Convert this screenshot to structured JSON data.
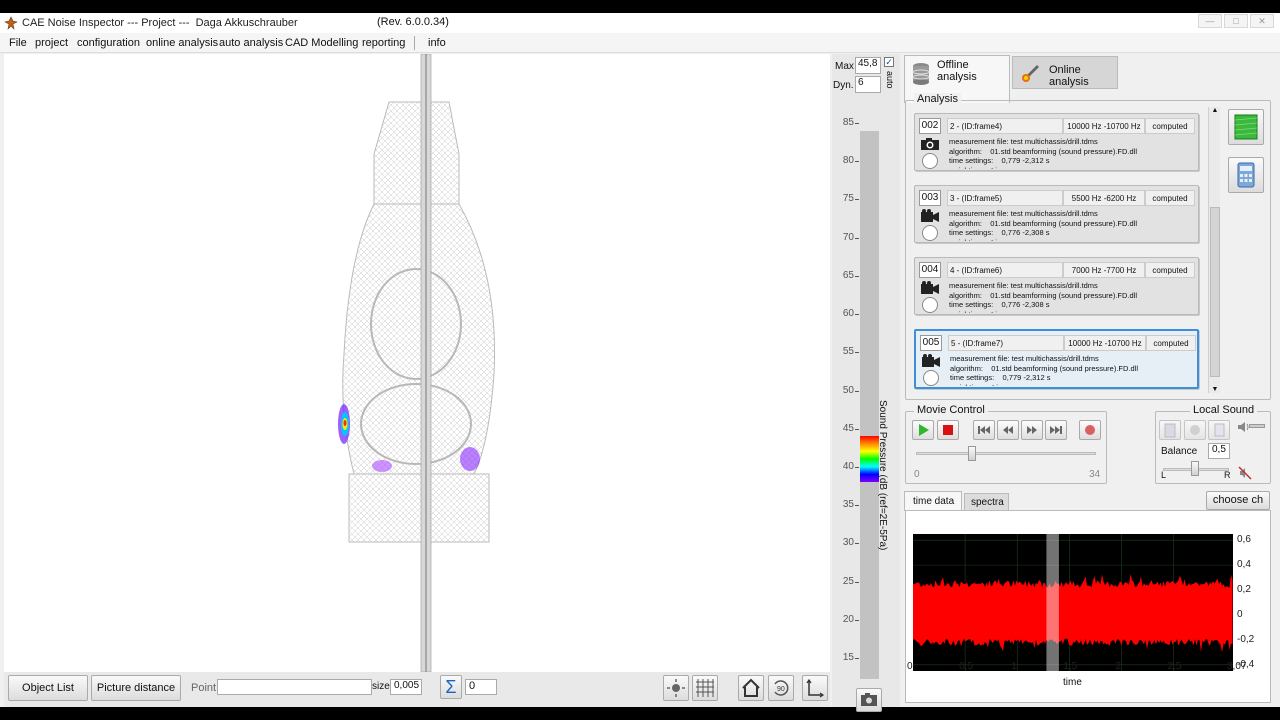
{
  "window": {
    "title": "CAE Noise Inspector --- Project ---  Daga Akkuschrauber",
    "revision": "(Rev. 6.0.0.34)"
  },
  "menu": [
    "File",
    "project",
    "configuration",
    "online analysis",
    "auto analysis",
    "CAD Modelling",
    "reporting",
    "info"
  ],
  "bottom_bar": {
    "object_list": "Object List",
    "picture_distance": "Picture distance",
    "point_label": "Point",
    "point_value": "",
    "size_label": "size",
    "size_value": "0,005",
    "sigma_symbol": "Σ",
    "sum_value": "0"
  },
  "scale": {
    "max_label": "Max",
    "max_value": "45,8",
    "dyn_label": "Dyn.",
    "dyn_value": "6",
    "auto_label": "auto",
    "auto_checked": true,
    "axis_title": "Sound Pressure (dB (ref=2E-5Pa)",
    "ticks": [
      "85",
      "80",
      "75",
      "70",
      "65",
      "60",
      "55",
      "50",
      "45",
      "40",
      "35",
      "30",
      "25",
      "20",
      "15"
    ]
  },
  "tabs": {
    "offline": "Offline analysis",
    "online": "Online analysis"
  },
  "analysis": {
    "title": "Analysis",
    "items": [
      {
        "num": "002",
        "name": "2 - (ID:frame4)",
        "freq": "10000 Hz -10700 Hz",
        "status": "computed",
        "details": "measurement file: test multichassis/drill.tdms\nalgorithm:    01.std beamforming (sound pressure).FD.dll\ntime settings:    0,779 -2,312 s\nweighting:    Linear"
      },
      {
        "num": "003",
        "name": "3 - (ID:frame5)",
        "freq": "5500 Hz -6200 Hz",
        "status": "computed",
        "details": "measurement file: test multichassis/drill.tdms\nalgorithm:    01.std beamforming (sound pressure).FD.dll\ntime settings:    0,776 -2,308 s\nweighting:    Linear"
      },
      {
        "num": "004",
        "name": "4 - (ID:frame6)",
        "freq": "7000 Hz -7700 Hz",
        "status": "computed",
        "details": "measurement file: test multichassis/drill.tdms\nalgorithm:    01.std beamforming (sound pressure).FD.dll\ntime settings:    0,776 -2,308 s\nweighting:    Linear"
      },
      {
        "num": "005",
        "name": "5 - (ID:frame7)",
        "freq": "10000 Hz -10700 Hz",
        "status": "computed",
        "details": "measurement file: test multichassis/drill.tdms\nalgorithm:    01.std beamforming (sound pressure).FD.dll\ntime settings:    0,779 -2,312 s\nweighting:    Linear"
      }
    ]
  },
  "movie_control": {
    "title": "Movie Control",
    "min": "0",
    "max": "34",
    "position_fraction": 0.3
  },
  "local_sound": {
    "title": "Local Sound",
    "balance_label": "Balance",
    "balance_value": "0,5",
    "left": "L",
    "right": "R"
  },
  "time_chart": {
    "tab_time": "time data",
    "tab_spectra": "spectra",
    "choose_button": "choose ch",
    "xlabel": "time",
    "x_ticks": [
      "0",
      "0,5",
      "1",
      "1,5",
      "2",
      "2,5",
      "3,07"
    ],
    "y_ticks": [
      "0,6",
      "0,4",
      "0,2",
      "0",
      "-0,2",
      "-0,4"
    ],
    "signal_color": "#ff0000",
    "background_color": "#000000",
    "selection_start": 1.28,
    "selection_end": 1.4
  }
}
